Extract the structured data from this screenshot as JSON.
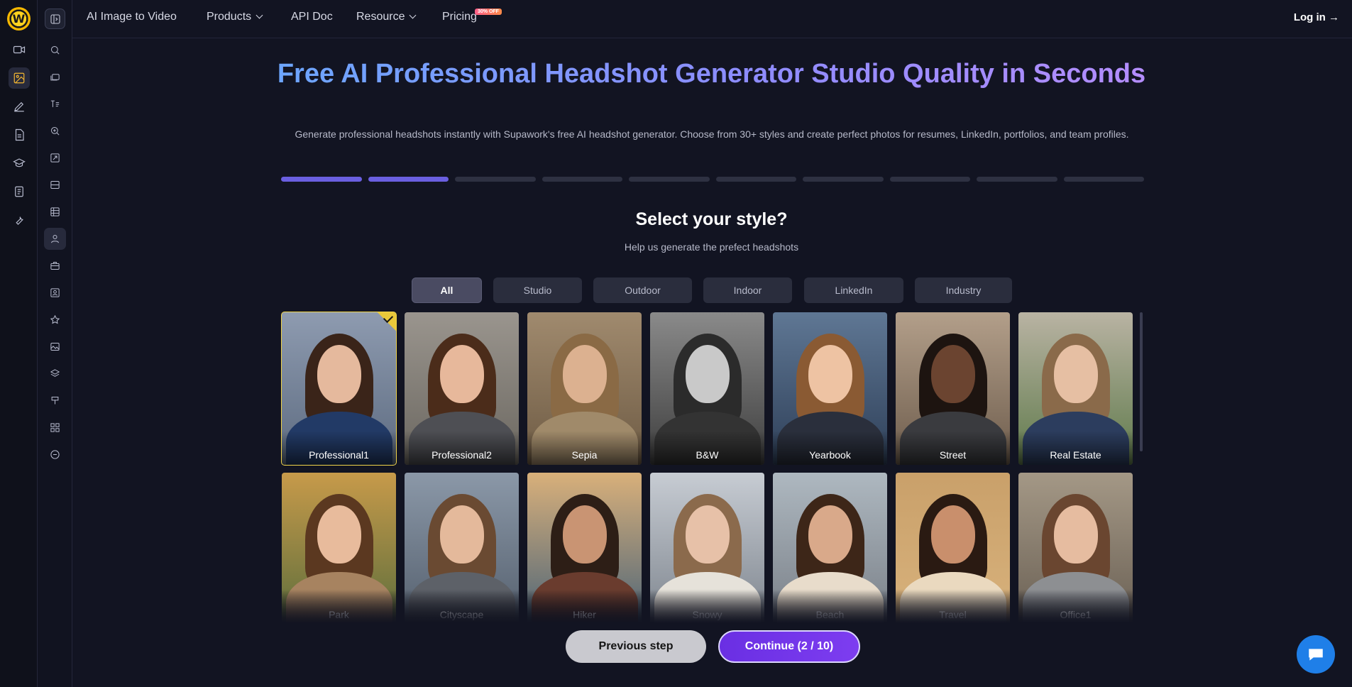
{
  "nav": {
    "items": [
      "AI Image to Video",
      "Products",
      "API Doc",
      "Resource",
      "Pricing"
    ],
    "pricing_badge": "30% OFF",
    "login": "Log in →"
  },
  "hero": {
    "title": "Free AI Professional Headshot Generator Studio Quality in Seconds",
    "subtitle": "Generate professional headshots instantly with Supawork's free AI headshot generator. Choose from 30+ styles and create perfect photos for resumes, LinkedIn, portfolios, and team profiles."
  },
  "progress": {
    "current": 2,
    "total": 10
  },
  "step": {
    "title": "Select your style?",
    "subtitle": "Help us generate the prefect headshots"
  },
  "filters": [
    "All",
    "Studio",
    "Outdoor",
    "Indoor",
    "LinkedIn",
    "Industry"
  ],
  "active_filter": "All",
  "styles": [
    {
      "name": "Professional1",
      "selected": true
    },
    {
      "name": "Professional2",
      "selected": false
    },
    {
      "name": "Sepia",
      "selected": false
    },
    {
      "name": "B&W",
      "selected": false
    },
    {
      "name": "Yearbook",
      "selected": false
    },
    {
      "name": "Street",
      "selected": false
    },
    {
      "name": "Real Estate",
      "selected": false
    },
    {
      "name": "Park",
      "selected": false
    },
    {
      "name": "Cityscape",
      "selected": false
    },
    {
      "name": "Hiker",
      "selected": false
    },
    {
      "name": "Snowy",
      "selected": false
    },
    {
      "name": "Beach",
      "selected": false
    },
    {
      "name": "Travel",
      "selected": false
    },
    {
      "name": "Office1",
      "selected": false
    }
  ],
  "buttons": {
    "previous": "Previous step",
    "continue": "Continue  (2 / 10)"
  },
  "colors": {
    "accent": "#7d3df0",
    "selected_border": "#f1d54a",
    "progress_done": "#6a5fe0",
    "brand_yellow": "#ffd21f",
    "chat": "#1f7fe8"
  }
}
